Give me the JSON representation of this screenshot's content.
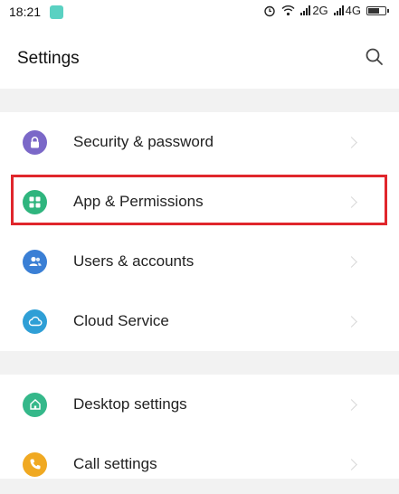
{
  "statusbar": {
    "time": "18:21",
    "signal_2g": "2G",
    "signal_4g": "4G"
  },
  "header": {
    "title": "Settings"
  },
  "settings_groups": [
    {
      "items": [
        {
          "label": "Security & password",
          "icon": "lock-icon",
          "color": "#7b68c8"
        },
        {
          "label": "App & Permissions",
          "icon": "apps-grid-icon",
          "color": "#2fb57e"
        },
        {
          "label": "Users & accounts",
          "icon": "users-icon",
          "color": "#3a7fd5"
        },
        {
          "label": "Cloud Service",
          "icon": "cloud-icon",
          "color": "#2f9fd6"
        }
      ]
    },
    {
      "items": [
        {
          "label": "Desktop settings",
          "icon": "home-icon",
          "color": "#35b88a"
        },
        {
          "label": "Call settings",
          "icon": "phone-icon",
          "color": "#f0a922"
        }
      ]
    }
  ],
  "highlight_color": "#e0262c"
}
